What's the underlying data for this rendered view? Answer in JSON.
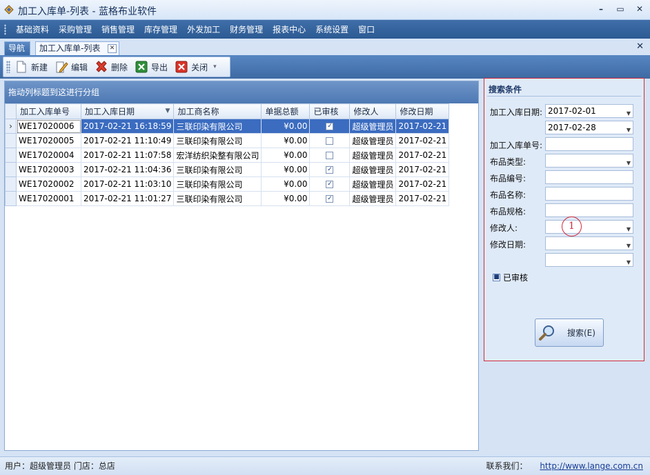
{
  "window": {
    "title": "加工入库单-列表 - 蓝格布业软件",
    "controls": [
      "–",
      "▭",
      "✕"
    ]
  },
  "menu": [
    "基础资料",
    "采购管理",
    "销售管理",
    "库存管理",
    "外发加工",
    "财务管理",
    "报表中心",
    "系统设置",
    "窗口"
  ],
  "tabs": {
    "nav": "导航",
    "active": "加工入库单-列表",
    "tab_close": "✕",
    "panel_close": "✕"
  },
  "toolbar": {
    "new": "新建",
    "edit": "编辑",
    "delete": "删除",
    "export": "导出",
    "close": "关闭"
  },
  "grid": {
    "group_hint": "拖动列标题到这进行分组",
    "columns": [
      "加工入库单号",
      "加工入库日期",
      "加工商名称",
      "单据总额",
      "已审核",
      "修改人",
      "修改日期"
    ],
    "rows": [
      {
        "no": "WE17020006",
        "date": "2017-02-21 16:18:59",
        "vendor": "三联印染有限公司",
        "amount": "¥0.00",
        "audited": true,
        "modifier": "超级管理员",
        "mod_date": "2017-02-21",
        "selected": true
      },
      {
        "no": "WE17020005",
        "date": "2017-02-21 11:10:49",
        "vendor": "三联印染有限公司",
        "amount": "¥0.00",
        "audited": false,
        "modifier": "超级管理员",
        "mod_date": "2017-02-21"
      },
      {
        "no": "WE17020004",
        "date": "2017-02-21 11:07:58",
        "vendor": "宏洋纺织染整有限公司",
        "amount": "¥0.00",
        "audited": false,
        "modifier": "超级管理员",
        "mod_date": "2017-02-21"
      },
      {
        "no": "WE17020003",
        "date": "2017-02-21 11:04:36",
        "vendor": "三联印染有限公司",
        "amount": "¥0.00",
        "audited": true,
        "modifier": "超级管理员",
        "mod_date": "2017-02-21"
      },
      {
        "no": "WE17020002",
        "date": "2017-02-21 11:03:10",
        "vendor": "三联印染有限公司",
        "amount": "¥0.00",
        "audited": true,
        "modifier": "超级管理员",
        "mod_date": "2017-02-21"
      },
      {
        "no": "WE17020001",
        "date": "2017-02-21 11:01:27",
        "vendor": "三联印染有限公司",
        "amount": "¥0.00",
        "audited": true,
        "modifier": "超级管理员",
        "mod_date": "2017-02-21"
      }
    ]
  },
  "search": {
    "title": "搜索条件",
    "date_label": "加工入库日期:",
    "date_from": "2017-02-01",
    "date_to": "2017-02-28",
    "no_label": "加工入库单号:",
    "type_label": "布品类型:",
    "code_label": "布品编号:",
    "name_label": "布品名称:",
    "spec_label": "布品规格:",
    "modifier_label": "修改人:",
    "mod_date_label": "修改日期:",
    "audited_label": "已审核",
    "button": "搜索(E)",
    "annotation": "1"
  },
  "status": {
    "user": "用户：超级管理员  门店：总店",
    "contact_label": "联系我们：",
    "url": "http://www.lange.com.cn"
  },
  "colors": {
    "menu_bg": "#3a66a0",
    "selection": "#3b6cc0",
    "annotation_red": "#d42a3a"
  }
}
